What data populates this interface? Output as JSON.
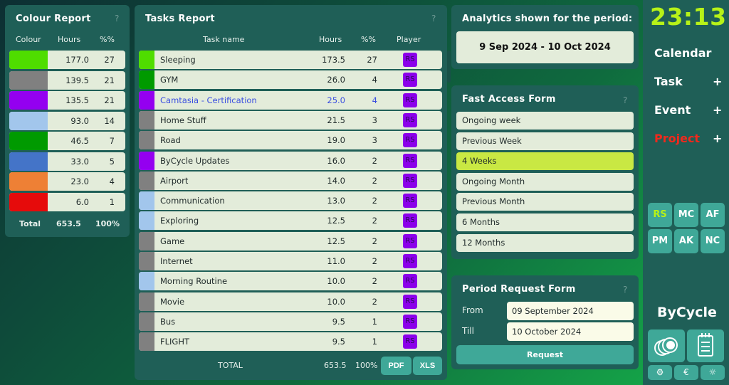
{
  "colour_report": {
    "title": "Colour Report",
    "help": "?",
    "headers": {
      "colour": "Colour",
      "hours": "Hours",
      "pct": "%%"
    },
    "rows": [
      {
        "color": "#4fdd00",
        "hours": "177.0",
        "pct": "27"
      },
      {
        "color": "#808080",
        "hours": "139.5",
        "pct": "21"
      },
      {
        "color": "#9400f0",
        "hours": "135.5",
        "pct": "21"
      },
      {
        "color": "#a2c6ec",
        "hours": "93.0",
        "pct": "14"
      },
      {
        "color": "#009a00",
        "hours": "46.5",
        "pct": "7"
      },
      {
        "color": "#4474c8",
        "hours": "33.0",
        "pct": "5"
      },
      {
        "color": "#ee8035",
        "hours": "23.0",
        "pct": "4"
      },
      {
        "color": "#e60b0b",
        "hours": "6.0",
        "pct": "1"
      }
    ],
    "total": {
      "label": "Total",
      "hours": "653.5",
      "pct": "100%"
    }
  },
  "tasks_report": {
    "title": "Tasks Report",
    "help": "?",
    "headers": {
      "name": "Task name",
      "hours": "Hours",
      "pct": "%%",
      "player": "Player"
    },
    "rows": [
      {
        "color": "#4fdd00",
        "name": "Sleeping",
        "hours": "173.5",
        "pct": "27",
        "player": "RS"
      },
      {
        "color": "#009a00",
        "name": "GYM",
        "hours": "26.0",
        "pct": "4",
        "player": "RS"
      },
      {
        "color": "#9400f0",
        "name": "Camtasia - Certification",
        "hours": "25.0",
        "pct": "4",
        "player": "RS",
        "highlight": true
      },
      {
        "color": "#808080",
        "name": "Home Stuff",
        "hours": "21.5",
        "pct": "3",
        "player": "RS"
      },
      {
        "color": "#808080",
        "name": "Road",
        "hours": "19.0",
        "pct": "3",
        "player": "RS"
      },
      {
        "color": "#9400f0",
        "name": "ByCycle Updates",
        "hours": "16.0",
        "pct": "2",
        "player": "RS"
      },
      {
        "color": "#808080",
        "name": "Airport",
        "hours": "14.0",
        "pct": "2",
        "player": "RS"
      },
      {
        "color": "#a2c6ec",
        "name": "Communication",
        "hours": "13.0",
        "pct": "2",
        "player": "RS"
      },
      {
        "color": "#a2c6ec",
        "name": "Exploring",
        "hours": "12.5",
        "pct": "2",
        "player": "RS"
      },
      {
        "color": "#808080",
        "name": "Game",
        "hours": "12.5",
        "pct": "2",
        "player": "RS"
      },
      {
        "color": "#808080",
        "name": "Internet",
        "hours": "11.0",
        "pct": "2",
        "player": "RS"
      },
      {
        "color": "#a2c6ec",
        "name": "Morning Routine",
        "hours": "10.0",
        "pct": "2",
        "player": "RS"
      },
      {
        "color": "#808080",
        "name": "Movie",
        "hours": "10.0",
        "pct": "2",
        "player": "RS"
      },
      {
        "color": "#808080",
        "name": "Bus",
        "hours": "9.5",
        "pct": "1",
        "player": "RS"
      },
      {
        "color": "#808080",
        "name": "FLIGHT",
        "hours": "9.5",
        "pct": "1",
        "player": "RS"
      }
    ],
    "total": {
      "label": "TOTAL",
      "hours": "653.5",
      "pct": "100%"
    },
    "pdf_label": "PDF",
    "xls_label": "XLS"
  },
  "analytics": {
    "title": "Analytics shown for the period:",
    "help": "?",
    "period": "9 Sep 2024 - 10 Oct 2024"
  },
  "fast_access": {
    "title": "Fast Access Form",
    "help": "?",
    "items": [
      {
        "label": "Ongoing week",
        "selected": false
      },
      {
        "label": "Previous Week",
        "selected": false
      },
      {
        "label": "4 Weeks",
        "selected": true
      },
      {
        "label": "Ongoing Month",
        "selected": false
      },
      {
        "label": "Previous Month",
        "selected": false
      },
      {
        "label": "6 Months",
        "selected": false
      },
      {
        "label": "12 Months",
        "selected": false
      }
    ]
  },
  "period_request": {
    "title": "Period Request Form",
    "help": "?",
    "from_label": "From",
    "from_value": "09 September 2024",
    "till_label": "Till",
    "till_value": "10 October 2024",
    "request_label": "Request"
  },
  "sidebar": {
    "clock": "23:13",
    "nav": [
      {
        "label": "Calendar",
        "plus": "",
        "color": "#ffffff"
      },
      {
        "label": "Task",
        "plus": "+",
        "color": "#ffffff"
      },
      {
        "label": "Event",
        "plus": "+",
        "color": "#ffffff"
      },
      {
        "label": "Project",
        "plus": "+",
        "color": "#f2281c"
      }
    ],
    "users": [
      "RS",
      "MC",
      "AF",
      "PM",
      "AK",
      "NC"
    ],
    "active_user": "RS",
    "brand": "ByCycle",
    "big_tiles": [
      "coins-icon",
      "notepad-icon"
    ],
    "small_tiles": [
      {
        "icon": "gear-icon",
        "glyph": "⚙"
      },
      {
        "icon": "euro-icon",
        "glyph": "€"
      },
      {
        "icon": "lightbulb-icon",
        "glyph": "☼"
      }
    ]
  }
}
